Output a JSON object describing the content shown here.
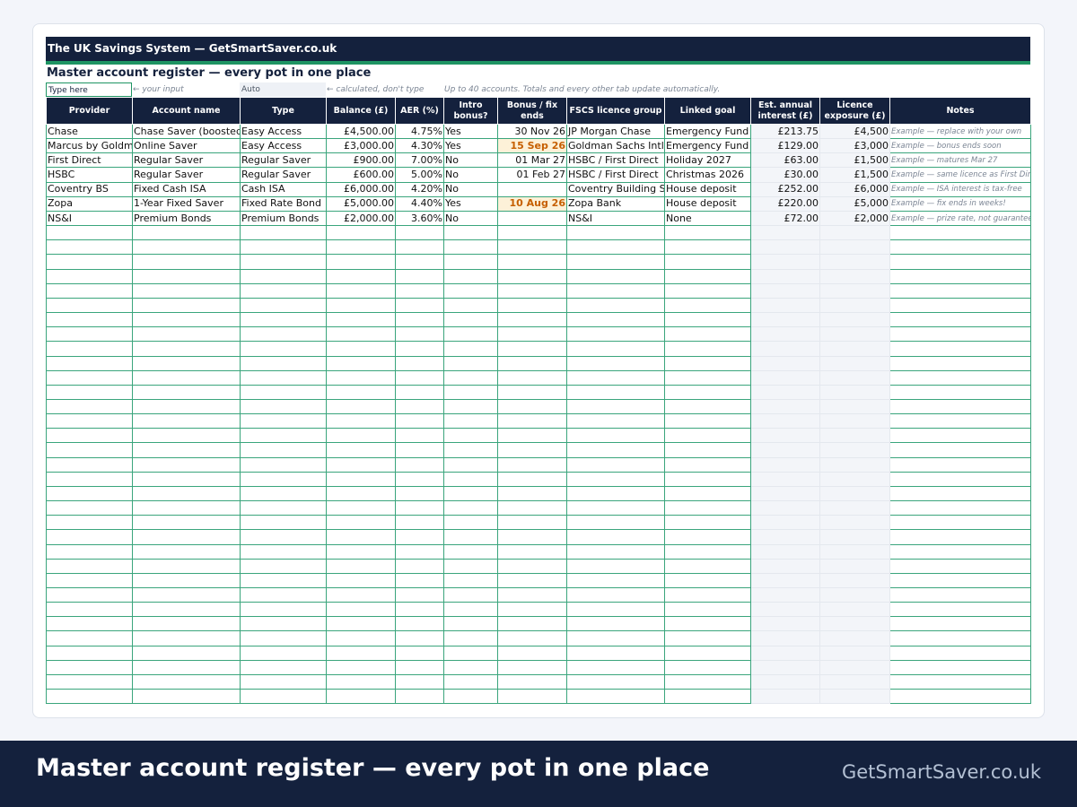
{
  "sheet": {
    "title": "The UK Savings System — GetSmartSaver.co.uk",
    "subtitle": "Master account register — every pot in one place",
    "legend": {
      "input_label": "Type here",
      "input_note": "← your input",
      "auto_label": "Auto",
      "auto_note": "← calculated, don't type",
      "info": "Up to 40 accounts. Totals and every other tab update automatically."
    },
    "columns": [
      "Provider",
      "Account name",
      "Type",
      "Balance (£)",
      "AER (%)",
      "Intro bonus?",
      "Bonus / fix ends",
      "FSCS licence group",
      "Linked goal",
      "Est. annual interest (£)",
      "Licence exposure (£)",
      "Notes"
    ],
    "rows": [
      {
        "provider": "Chase",
        "account": "Chase Saver (boosted)",
        "type": "Easy Access",
        "balance": "£4,500.00",
        "aer": "4.75%",
        "bonus": "Yes",
        "ends": "30 Nov 26",
        "ends_hl": false,
        "fscs": "JP Morgan Chase",
        "goal": "Emergency Fund",
        "interest": "£213.75",
        "exposure": "£4,500",
        "notes": "Example — replace with your own"
      },
      {
        "provider": "Marcus by Goldman Sachs",
        "account": "Online Saver",
        "type": "Easy Access",
        "balance": "£3,000.00",
        "aer": "4.30%",
        "bonus": "Yes",
        "ends": "15 Sep 26",
        "ends_hl": true,
        "fscs": "Goldman Sachs Intl Bank",
        "goal": "Emergency Fund",
        "interest": "£129.00",
        "exposure": "£3,000",
        "notes": "Example — bonus ends soon"
      },
      {
        "provider": "First Direct",
        "account": "Regular Saver",
        "type": "Regular Saver",
        "balance": "£900.00",
        "aer": "7.00%",
        "bonus": "No",
        "ends": "01 Mar 27",
        "ends_hl": false,
        "fscs": "HSBC / First Direct",
        "goal": "Holiday 2027",
        "interest": "£63.00",
        "exposure": "£1,500",
        "notes": "Example — matures Mar 27"
      },
      {
        "provider": "HSBC",
        "account": "Regular Saver",
        "type": "Regular Saver",
        "balance": "£600.00",
        "aer": "5.00%",
        "bonus": "No",
        "ends": "01 Feb 27",
        "ends_hl": false,
        "fscs": "HSBC / First Direct",
        "goal": "Christmas 2026",
        "interest": "£30.00",
        "exposure": "£1,500",
        "notes": "Example — same licence as First Direct"
      },
      {
        "provider": "Coventry BS",
        "account": "Fixed Cash ISA",
        "type": "Cash ISA",
        "balance": "£6,000.00",
        "aer": "4.20%",
        "bonus": "No",
        "ends": "",
        "ends_hl": false,
        "fscs": "Coventry Building Society",
        "goal": "House deposit",
        "interest": "£252.00",
        "exposure": "£6,000",
        "notes": "Example — ISA interest is tax-free"
      },
      {
        "provider": "Zopa",
        "account": "1-Year Fixed Saver",
        "type": "Fixed Rate Bond",
        "balance": "£5,000.00",
        "aer": "4.40%",
        "bonus": "Yes",
        "ends": "10 Aug 26",
        "ends_hl": true,
        "fscs": "Zopa Bank",
        "goal": "House deposit",
        "interest": "£220.00",
        "exposure": "£5,000",
        "notes": "Example — fix ends in weeks!"
      },
      {
        "provider": "NS&I",
        "account": "Premium Bonds",
        "type": "Premium Bonds",
        "balance": "£2,000.00",
        "aer": "3.60%",
        "bonus": "No",
        "ends": "",
        "ends_hl": false,
        "fscs": "NS&I",
        "goal": "None",
        "interest": "£72.00",
        "exposure": "£2,000",
        "notes": "Example — prize rate, not guaranteed"
      }
    ]
  },
  "footer": {
    "title": "Master account register — every pot in one place",
    "site": "GetSmartSaver.co.uk"
  },
  "colors": {
    "navy": "#14213d",
    "green": "#1e9463",
    "highlight": "#c65f00"
  }
}
